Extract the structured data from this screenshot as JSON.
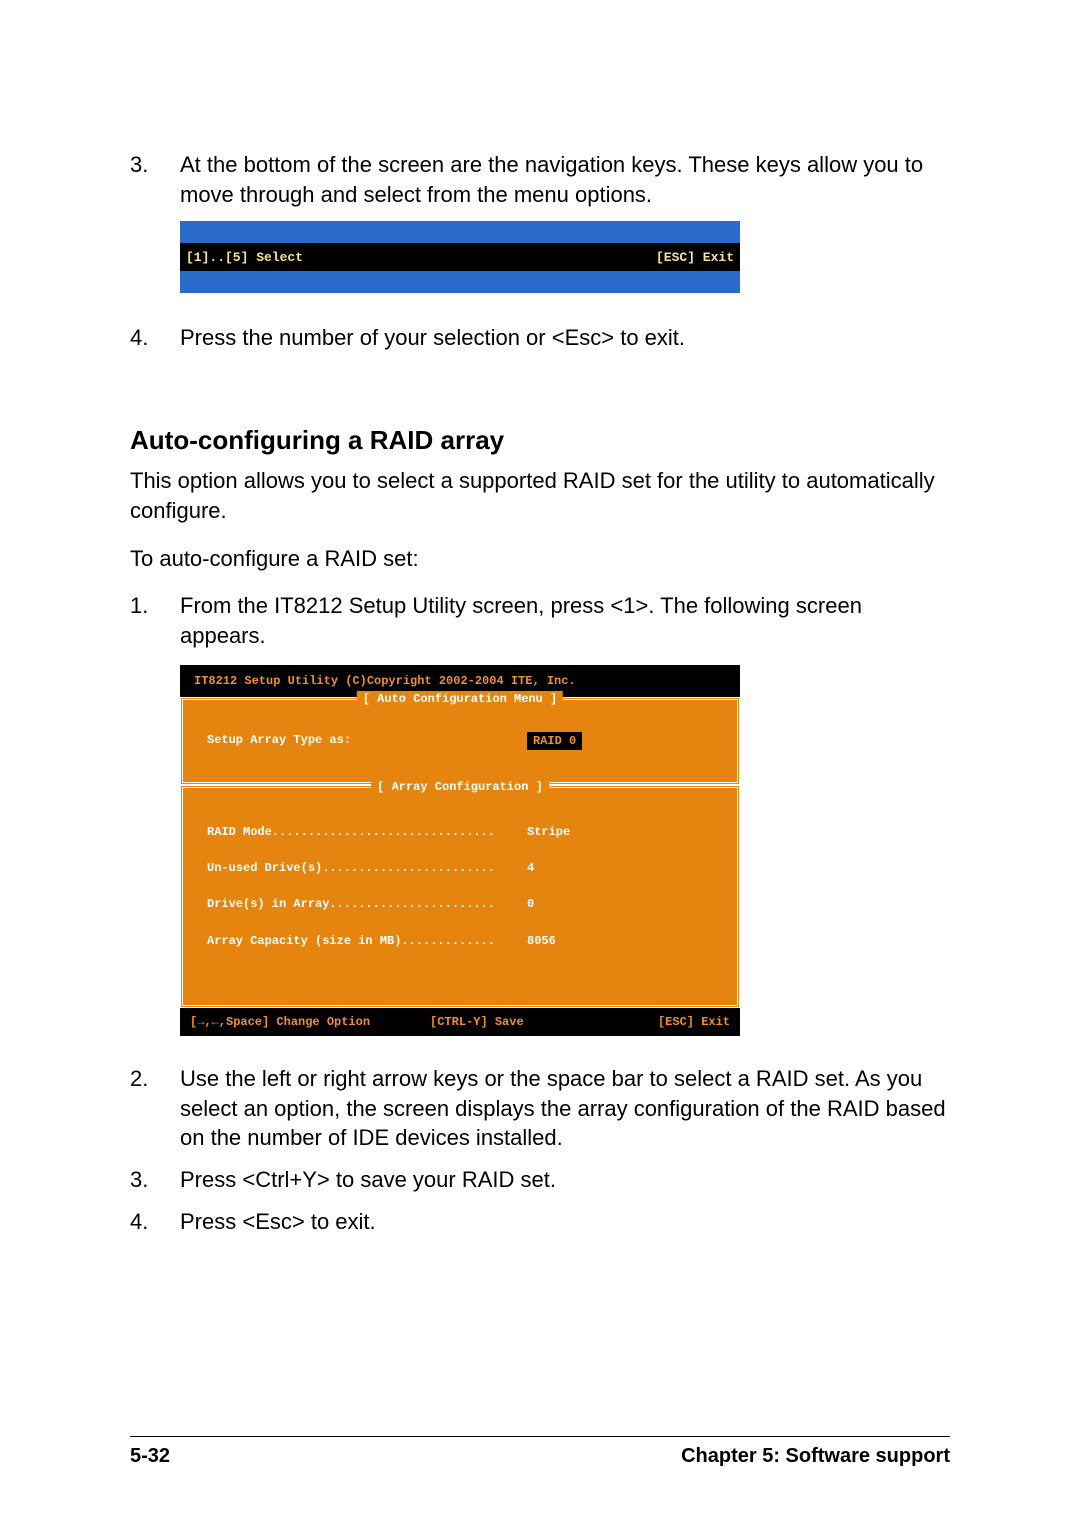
{
  "steps": {
    "s3": {
      "num": "3.",
      "text": "At the bottom of the screen are the navigation keys. These keys allow you to move through and select from the menu options."
    },
    "s4": {
      "num": "4.",
      "text": "Press the number of your selection or <Esc> to exit."
    }
  },
  "navbar": {
    "left": "[1]..[5] Select",
    "right": "[ESC] Exit"
  },
  "section": {
    "title": "Auto-configuring a RAID array",
    "intro": "This option allows you to select a supported RAID set for the utility to automatically configure.",
    "lead": "To auto-configure a RAID set:"
  },
  "auto_steps": {
    "a1": {
      "num": "1.",
      "text": "From the IT8212 Setup Utility screen, press <1>. The following screen appears."
    },
    "a2": {
      "num": "2.",
      "text": "Use the left or right arrow keys or the space bar to select a RAID set. As you select an option, the screen displays the array configuration of the RAID based on the number of IDE devices installed."
    },
    "a3": {
      "num": "3.",
      "text": "Press <Ctrl+Y> to save your RAID set."
    },
    "a4": {
      "num": "4.",
      "text": "Press <Esc> to exit."
    }
  },
  "it8": {
    "header": "IT8212 Setup Utility (C)Copyright 2002-2004 ITE, Inc.",
    "panel1": {
      "title": "[ Auto Configuration Menu ]",
      "row": {
        "label": "Setup Array Type as:",
        "value": "RAID 0"
      }
    },
    "panel2": {
      "title": "[ Array Configuration ]",
      "rows": {
        "r1": {
          "label": "RAID Mode...............................",
          "value": "Stripe"
        },
        "r2": {
          "label": "Un-used Drive(s)........................",
          "value": "4"
        },
        "r3": {
          "label": "Drive(s) in Array.......................",
          "value": "0"
        },
        "r4": {
          "label": "Array Capacity (size in MB).............",
          "value": "8056"
        }
      }
    },
    "footer": {
      "left1": "[→,←,Space] Change Option",
      "left2": "[CTRL-Y] Save",
      "right": "[ESC] Exit"
    }
  },
  "page_footer": {
    "left": "5-32",
    "right": "Chapter 5: Software support"
  }
}
